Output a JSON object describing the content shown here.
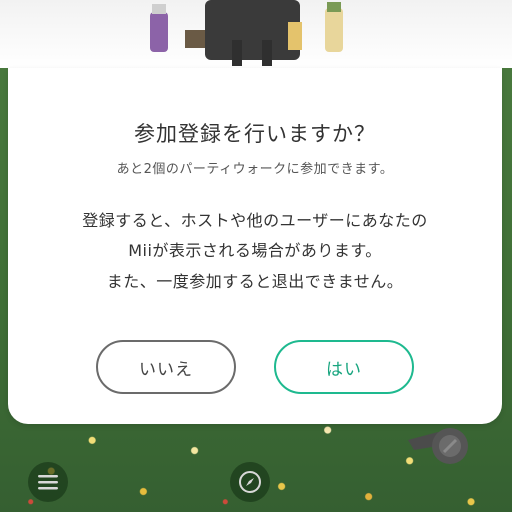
{
  "dialog": {
    "title": "参加登録を行いますか？",
    "subtitle": "あと2個のパーティウォークに参加できます。",
    "body_lines": [
      "登録すると、ホストや他のユーザーにあなたの",
      "Miiが表示される場合があります。",
      "また、一度参加すると退出できません。"
    ],
    "buttons": {
      "no": "いいえ",
      "yes": "はい"
    }
  },
  "icons": {
    "menu": "menu-icon",
    "compass": "compass-icon",
    "whistle": "whistle-icon"
  },
  "colors": {
    "accent": "#1eb98f",
    "neutral_border": "#6b6b6b",
    "background": "#3e6a37"
  }
}
